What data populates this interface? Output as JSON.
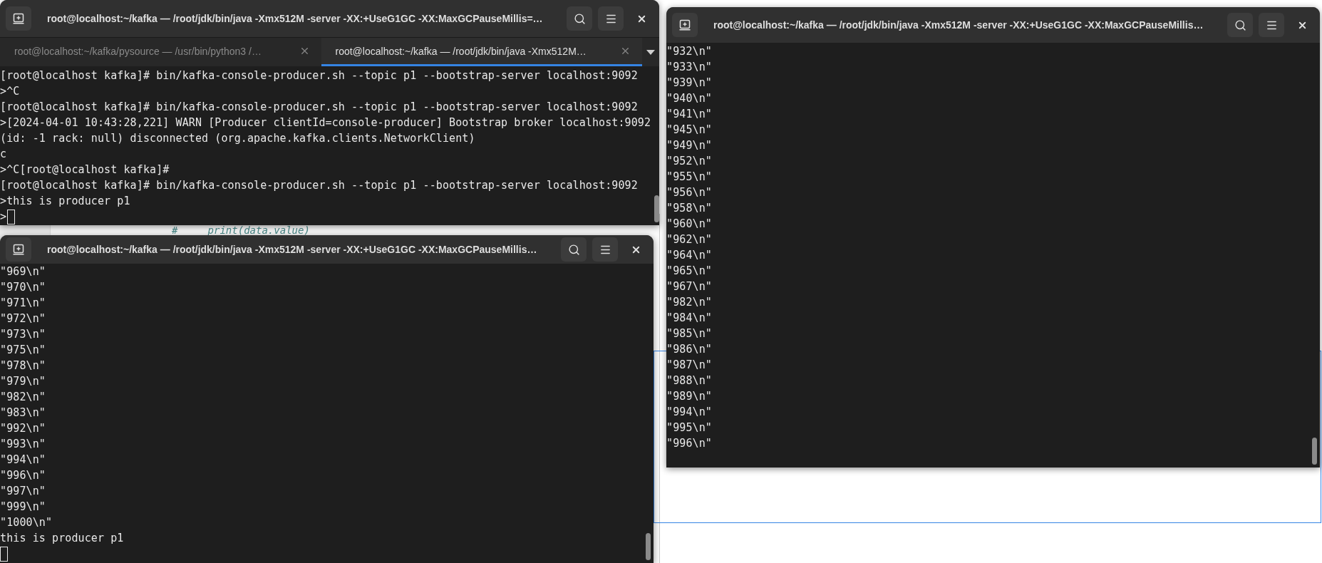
{
  "background_editor": {
    "lines": [
      "#     print(data.value)"
    ]
  },
  "windows": [
    {
      "title": "root@localhost:~/kafka — /root/jdk/bin/java -Xmx512M -server -XX:+UseG1GC -XX:MaxGCPauseMillis=…",
      "tabs": [
        {
          "label": "root@localhost:~/kafka/pysource — /usr/bin/python3 /…",
          "selected": false
        },
        {
          "label": "root@localhost:~/kafka — /root/jdk/bin/java -Xmx512M…",
          "selected": true
        }
      ],
      "lines": [
        "[root@localhost kafka]# bin/kafka-console-producer.sh --topic p1 --bootstrap-server localhost:9092",
        ">^C",
        "[root@localhost kafka]# bin/kafka-console-producer.sh --topic p1 --bootstrap-server localhost:9092",
        ">[2024-04-01 10:43:28,221] WARN [Producer clientId=console-producer] Bootstrap broker localhost:9092",
        "(id: -1 rack: null) disconnected (org.apache.kafka.clients.NetworkClient)",
        "c",
        ">^C[root@localhost kafka]#",
        "[root@localhost kafka]# bin/kafka-console-producer.sh --topic p1 --bootstrap-server localhost:9092",
        ">this is producer p1"
      ],
      "prompt": ">",
      "cursor": true
    },
    {
      "title": "root@localhost:~/kafka — /root/jdk/bin/java -Xmx512M -server -XX:+UseG1GC -XX:MaxGCPauseMillis…",
      "lines": [
        "\"969\\n\"",
        "\"970\\n\"",
        "\"971\\n\"",
        "\"972\\n\"",
        "\"973\\n\"",
        "\"975\\n\"",
        "\"978\\n\"",
        "\"979\\n\"",
        "\"982\\n\"",
        "\"983\\n\"",
        "\"992\\n\"",
        "\"993\\n\"",
        "\"994\\n\"",
        "\"996\\n\"",
        "\"997\\n\"",
        "\"999\\n\"",
        "\"1000\\n\"",
        "this is producer p1"
      ],
      "cursor": true
    },
    {
      "title": "root@localhost:~/kafka — /root/jdk/bin/java -Xmx512M -server -XX:+UseG1GC -XX:MaxGCPauseMillis…",
      "lines": [
        "\"932\\n\"",
        "\"933\\n\"",
        "\"939\\n\"",
        "\"940\\n\"",
        "\"941\\n\"",
        "\"945\\n\"",
        "\"949\\n\"",
        "\"952\\n\"",
        "\"955\\n\"",
        "\"956\\n\"",
        "\"958\\n\"",
        "\"960\\n\"",
        "\"962\\n\"",
        "\"964\\n\"",
        "\"965\\n\"",
        "\"967\\n\"",
        "\"982\\n\"",
        "\"984\\n\"",
        "\"985\\n\"",
        "\"986\\n\"",
        "\"987\\n\"",
        "\"988\\n\"",
        "\"989\\n\"",
        "\"994\\n\"",
        "\"995\\n\"",
        "\"996\\n\""
      ],
      "cursor": false
    }
  ]
}
